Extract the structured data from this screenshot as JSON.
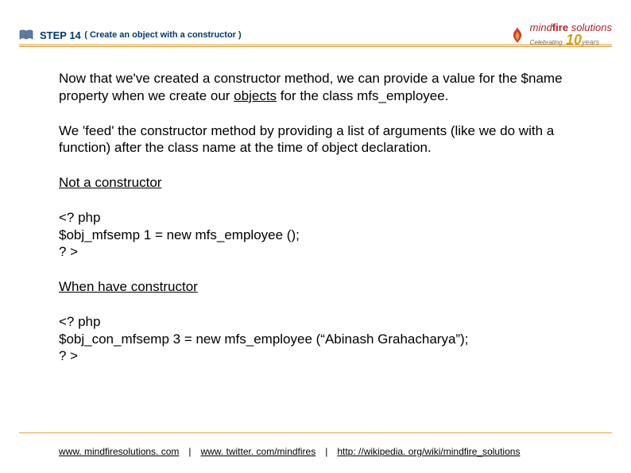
{
  "header": {
    "step_title": "STEP 14",
    "step_sub": "( Create an object with a constructor  )"
  },
  "logo": {
    "brand_prefix": "mind",
    "brand_strong": "fire",
    "brand_suffix": " solutions",
    "celebrate": "Celebrating",
    "years_num": "10",
    "years_text": "years"
  },
  "content": {
    "p1_a": "Now that we've created a constructor method, we can provide a value for the $name property when we create our ",
    "p1_link": "objects",
    "p1_b": " for the class  mfs_employee.",
    "p2": "We 'feed' the constructor method by providing a list of arguments (like we do with a function) after the class name at the time of object declaration.",
    "not_constructor": "Not a constructor",
    "code1_l1": "<? php",
    "code1_l2": "$obj_mfsemp 1 = new mfs_employee ();",
    "code1_l3": "? >",
    "when_have": "When have constructor",
    "code2_l1": "<? php",
    "code2_l2": "$obj_con_mfsemp 3 = new mfs_employee (“Abinash Grahacharya”);",
    "code2_l3": "? >"
  },
  "footer": {
    "link1": "www. mindfiresolutions. com",
    "sep": "|",
    "link2": "www. twitter. com/mindfires",
    "link3": "http: //wikipedia. org/wiki/mindfire_solutions"
  }
}
